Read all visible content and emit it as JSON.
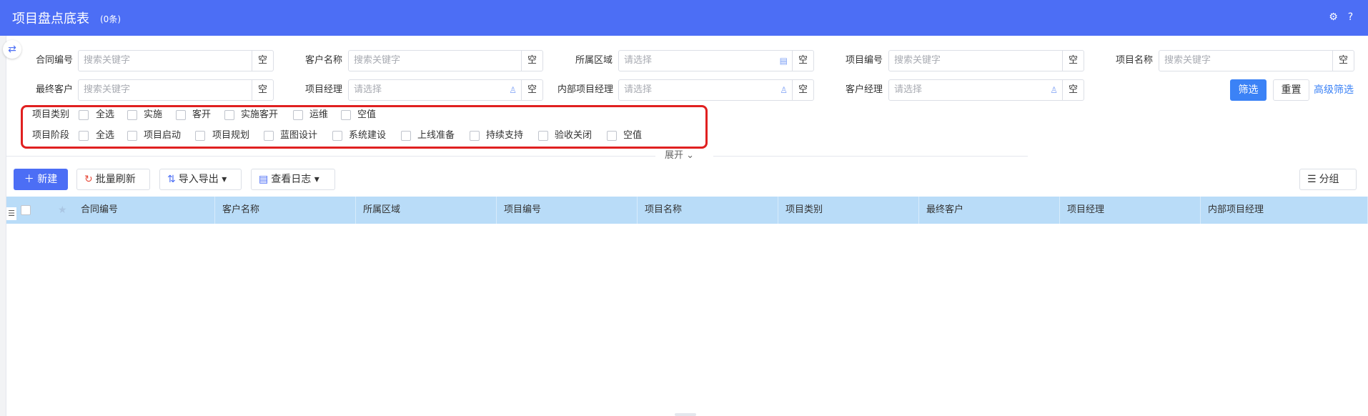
{
  "header": {
    "title": "项目盘点底表",
    "count": "(0条)",
    "icons": [
      "gear-icon",
      "help-icon"
    ]
  },
  "filters": {
    "kong": "空",
    "fields": [
      {
        "label": "合同编号",
        "placeholder": "搜索关键字",
        "type": "text"
      },
      {
        "label": "客户名称",
        "placeholder": "搜索关键字",
        "type": "text"
      },
      {
        "label": "所属区域",
        "placeholder": "请选择",
        "type": "select",
        "icon": "calendar-icon"
      },
      {
        "label": "项目编号",
        "placeholder": "搜索关键字",
        "type": "text"
      },
      {
        "label": "项目名称",
        "placeholder": "搜索关键字",
        "type": "text"
      },
      {
        "label": "最终客户",
        "placeholder": "搜索关键字",
        "type": "text"
      },
      {
        "label": "项目经理",
        "placeholder": "请选择",
        "type": "select",
        "icon": "user-icon"
      },
      {
        "label": "内部项目经理",
        "placeholder": "请选择",
        "type": "select",
        "icon": "user-icon"
      },
      {
        "label": "客户经理",
        "placeholder": "请选择",
        "type": "select",
        "icon": "user-icon"
      }
    ],
    "buttons": {
      "filter": "筛选",
      "reset": "重置",
      "advanced": "高级筛选"
    }
  },
  "checkbox_groups": [
    {
      "label": "项目类别",
      "options": [
        "全选",
        "实施",
        "客开",
        "实施客开",
        "运维",
        "空值"
      ]
    },
    {
      "label": "项目阶段",
      "options": [
        "全选",
        "项目启动",
        "项目规划",
        "蓝图设计",
        "系统建设",
        "上线准备",
        "持续支持",
        "验收关闭",
        "空值"
      ]
    }
  ],
  "expand_label": "展开",
  "toolbar": {
    "new": "新建",
    "refresh": "批量刷新",
    "import_export": "导入导出",
    "view_log": "查看日志",
    "group": "分组"
  },
  "table": {
    "columns": [
      "合同编号",
      "客户名称",
      "所属区域",
      "项目编号",
      "项目名称",
      "项目类别",
      "最终客户",
      "项目经理",
      "内部项目经理"
    ]
  },
  "colors": {
    "header_bg": "#4c6ef5",
    "primary": "#3b82f6",
    "table_header_bg": "#b9dcf8",
    "highlight_box": "#e02020"
  }
}
